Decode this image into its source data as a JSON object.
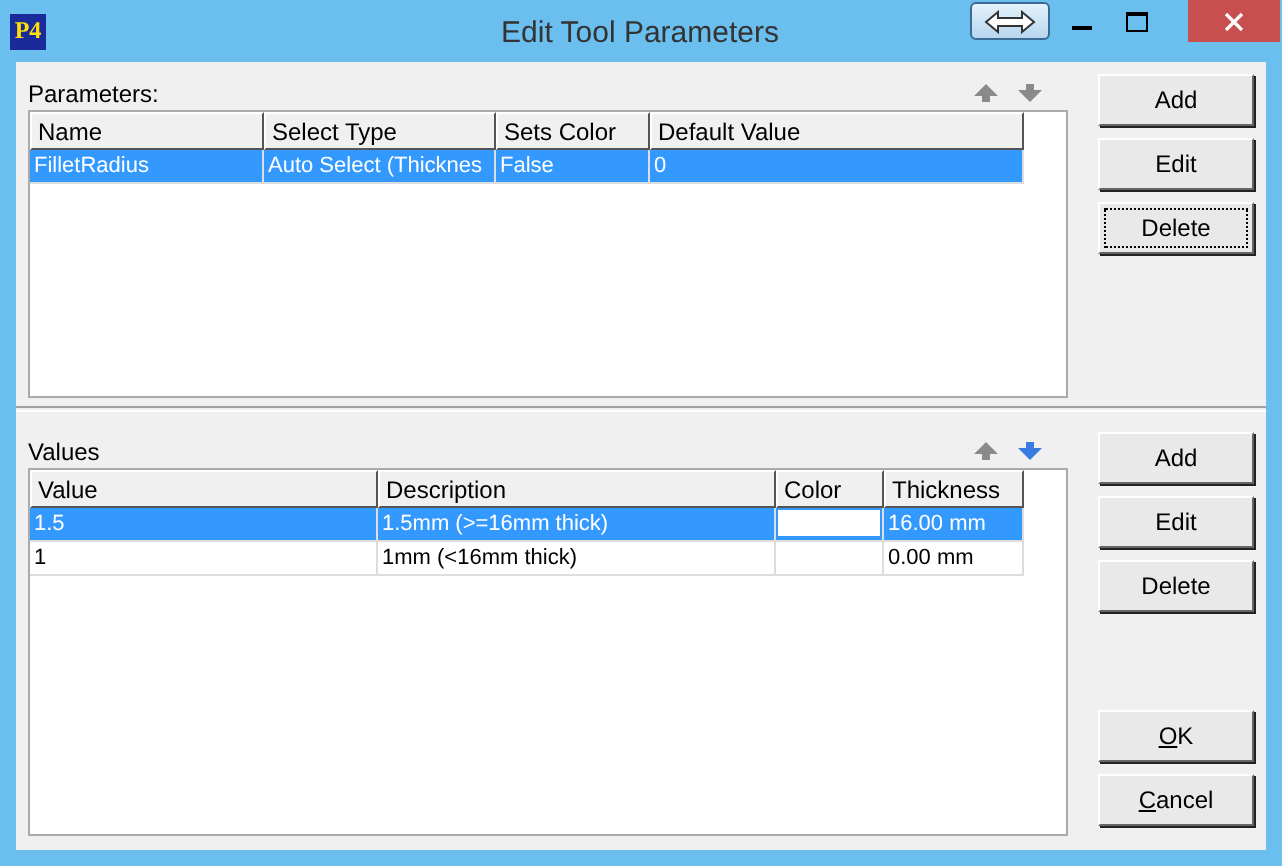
{
  "window": {
    "title": "Edit Tool Parameters",
    "app_icon": "P4"
  },
  "parameters": {
    "label": "Parameters:",
    "move_up": {
      "enabled": false
    },
    "move_down": {
      "enabled": false
    },
    "columns": [
      "Name",
      "Select Type",
      "Sets Color",
      "Default Value"
    ],
    "rows": [
      {
        "cells": [
          "FilletRadius",
          "Auto Select (Thicknes",
          "False",
          "0"
        ],
        "selected": true
      }
    ],
    "buttons": [
      {
        "label": "Add",
        "focused": false
      },
      {
        "label": "Edit",
        "focused": false
      },
      {
        "label": "Delete",
        "focused": true
      }
    ]
  },
  "values": {
    "label": "Values",
    "move_up": {
      "enabled": false
    },
    "move_down": {
      "enabled": true
    },
    "columns": [
      "Value",
      "Description",
      "Color",
      "Thickness"
    ],
    "rows": [
      {
        "cells": [
          "1.5",
          "1.5mm (>=16mm thick)",
          "",
          "16.00 mm"
        ],
        "selected": true,
        "color": "#ffffff"
      },
      {
        "cells": [
          "1",
          "1mm (<16mm thick)",
          "",
          "0.00 mm"
        ],
        "selected": false
      }
    ],
    "buttons": [
      {
        "label": "Add",
        "focused": false
      },
      {
        "label": "Edit",
        "focused": false
      },
      {
        "label": "Delete",
        "focused": false
      }
    ]
  },
  "dialog_buttons": [
    {
      "label": "OK",
      "mnemonic_underlined": true
    },
    {
      "label": "Cancel",
      "mnemonic_underlined": true
    }
  ]
}
